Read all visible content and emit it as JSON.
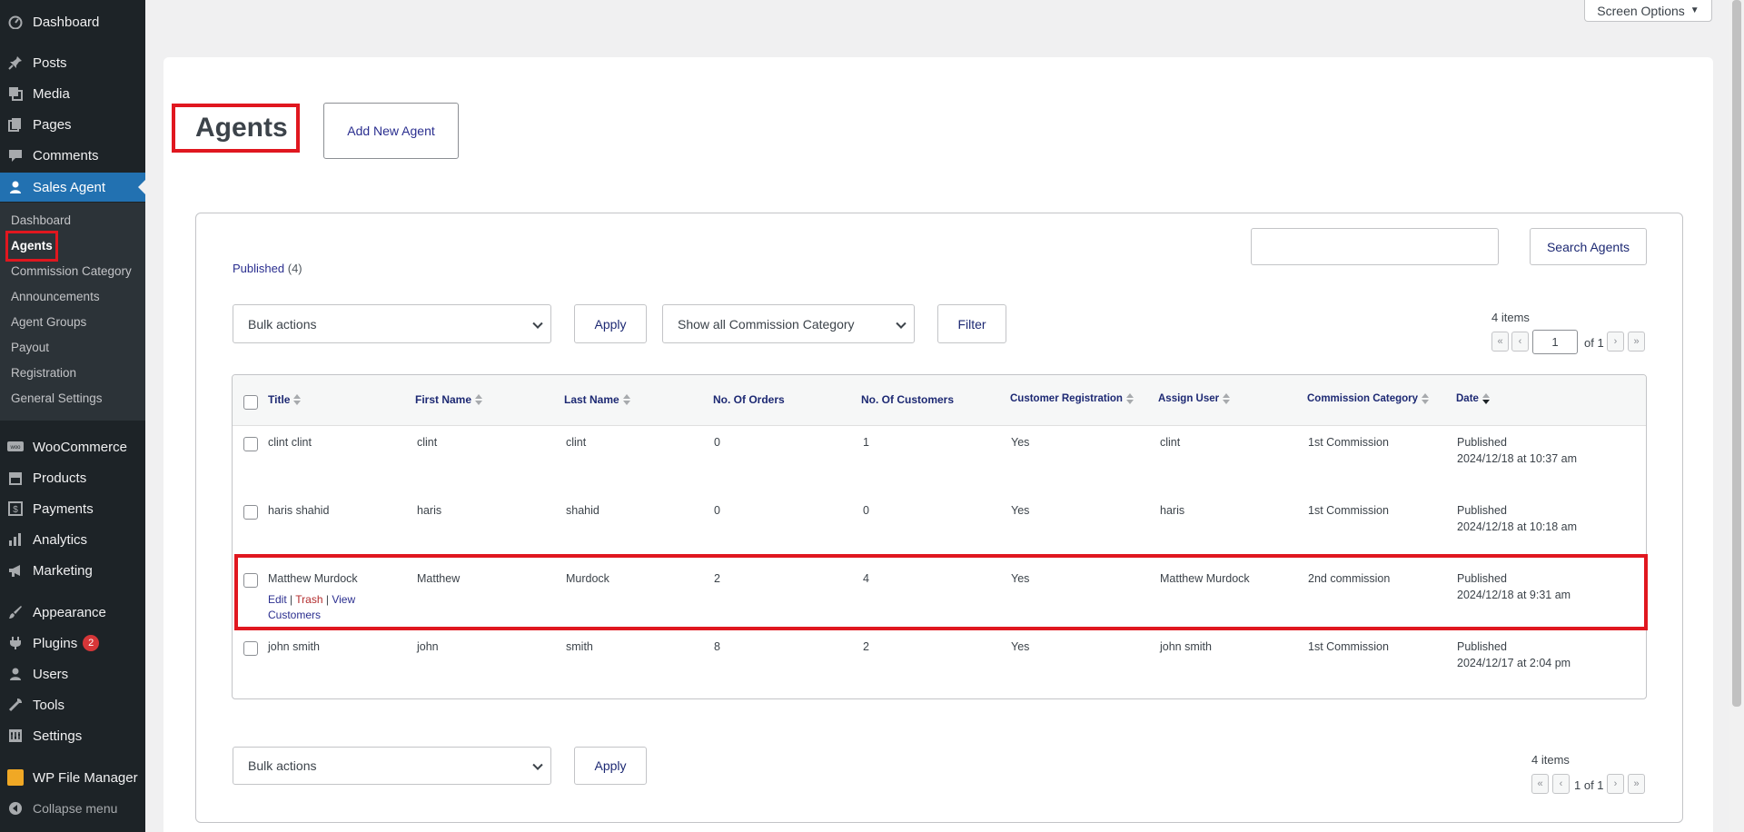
{
  "sidebar": {
    "menu": [
      {
        "label": "Dashboard",
        "icon": "dashboard-icon"
      },
      {
        "label": "Posts",
        "icon": "pin-icon"
      },
      {
        "label": "Media",
        "icon": "media-icon"
      },
      {
        "label": "Pages",
        "icon": "pages-icon"
      },
      {
        "label": "Comments",
        "icon": "comment-icon"
      },
      {
        "label": "Sales Agent",
        "icon": "user-icon"
      },
      {
        "label": "WooCommerce",
        "icon": "woo-icon"
      },
      {
        "label": "Products",
        "icon": "archive-icon"
      },
      {
        "label": "Payments",
        "icon": "dollar-icon"
      },
      {
        "label": "Analytics",
        "icon": "bar-chart-icon"
      },
      {
        "label": "Marketing",
        "icon": "megaphone-icon"
      },
      {
        "label": "Appearance",
        "icon": "brush-icon"
      },
      {
        "label": "Plugins",
        "icon": "plugin-icon",
        "badge": "2"
      },
      {
        "label": "Users",
        "icon": "users-icon"
      },
      {
        "label": "Tools",
        "icon": "wrench-icon"
      },
      {
        "label": "Settings",
        "icon": "settings-icon"
      },
      {
        "label": "WP File Manager",
        "icon": "file-manager-icon"
      },
      {
        "label": "Collapse menu",
        "icon": "collapse-icon"
      }
    ],
    "submenu": [
      "Dashboard",
      "Agents",
      "Commission Category",
      "Announcements",
      "Agent Groups",
      "Payout",
      "Registration",
      "General Settings"
    ]
  },
  "screen_options": "Screen Options",
  "page_title": "Agents",
  "add_new_label": "Add New Agent",
  "filters": {
    "published_label": "Published",
    "published_count": "(4)",
    "search_button": "Search Agents",
    "search_value": "",
    "bulk_actions": "Bulk actions",
    "apply": "Apply",
    "category_filter": "Show all Commission Category",
    "filter_button": "Filter"
  },
  "pagination_top": {
    "items": "4 items",
    "current_page": "1",
    "of_text": "of 1"
  },
  "pagination_bottom": {
    "items": "4 items",
    "text": "1 of 1"
  },
  "pagination_glyphs": {
    "first": "«",
    "prev": "‹",
    "next": "›",
    "last": "»"
  },
  "table": {
    "columns": [
      "Title",
      "First Name",
      "Last Name",
      "No. Of Orders",
      "No. Of Customers",
      "Customer Registration",
      "Assign User",
      "Commission Category",
      "Date"
    ],
    "rows": [
      {
        "title": "clint clint",
        "first": "clint",
        "last": "clint",
        "orders": "0",
        "customers": "1",
        "registration": "Yes",
        "user": "clint",
        "category": "1st Commission",
        "status": "Published",
        "date": "2024/12/18 at 10:37 am"
      },
      {
        "title": "haris shahid",
        "first": "haris",
        "last": "shahid",
        "orders": "0",
        "customers": "0",
        "registration": "Yes",
        "user": "haris",
        "category": "1st Commission",
        "status": "Published",
        "date": "2024/12/18 at 10:18 am"
      },
      {
        "title": "Matthew Murdock",
        "first": "Matthew",
        "last": "Murdock",
        "orders": "2",
        "customers": "4",
        "registration": "Yes",
        "user": "Matthew Murdock",
        "category": "2nd commission",
        "status": "Published",
        "date": "2024/12/18 at 9:31 am"
      },
      {
        "title": "john smith",
        "first": "john",
        "last": "smith",
        "orders": "8",
        "customers": "2",
        "registration": "Yes",
        "user": "john smith",
        "category": "1st Commission",
        "status": "Published",
        "date": "2024/12/17 at 2:04 pm"
      }
    ],
    "row_actions": {
      "edit": "Edit",
      "trash": "Trash",
      "view_line1": "View",
      "view_line2": "Customers",
      "sep": "|"
    }
  }
}
